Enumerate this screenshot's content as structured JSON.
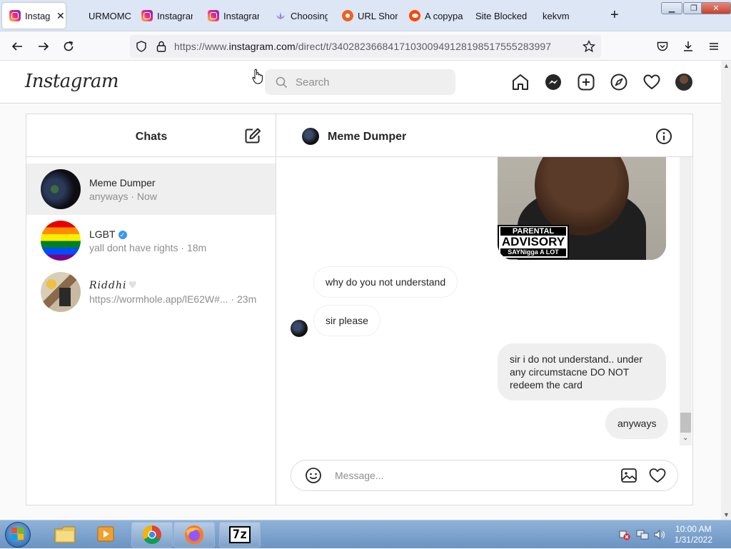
{
  "browser": {
    "tabs": [
      {
        "label": "Instagram",
        "icon": "instagram-icon",
        "active": true
      },
      {
        "label": "URMOMC",
        "icon": "none"
      },
      {
        "label": "Instagram",
        "icon": "instagram-icon"
      },
      {
        "label": "Instagram",
        "icon": "instagram-icon"
      },
      {
        "label": "Choosing",
        "icon": "lotus-icon"
      },
      {
        "label": "URL Short",
        "icon": "bitly-icon"
      },
      {
        "label": "A copypa",
        "icon": "reddit-icon"
      },
      {
        "label": "Site Blocked",
        "icon": "none"
      },
      {
        "label": "kekvm",
        "icon": "none"
      }
    ],
    "new_tab": "+",
    "url_prefix": "https://www.",
    "url_domain": "instagram.com",
    "url_path": "/direct/t/340282366841710300949128198517555283997"
  },
  "instagram": {
    "logo": "Instagram",
    "search_placeholder": "Search",
    "chats_title": "Chats",
    "chats": [
      {
        "name": "Meme Dumper",
        "last": "anyways",
        "time": "Now",
        "selected": true
      },
      {
        "name": "LGBT",
        "verified": true,
        "last": "yall dont have rights",
        "time": "18m"
      },
      {
        "name": "𝑅𝑖𝑑𝑑ℎ𝑖",
        "last": "https://wormhole.app/lE62W#...",
        "time": "23m"
      }
    ],
    "conversation": {
      "name": "Meme Dumper",
      "image_text": {
        "line1": "PARENTAL",
        "line2": "ADVISORY",
        "line3": "SAYNigga A LOT"
      },
      "messages": [
        {
          "text": "why do you not understand",
          "direction": "incoming"
        },
        {
          "text": "sir please",
          "direction": "incoming"
        },
        {
          "text": "sir i do not understand.. under any circumstacne DO NOT redeem the card",
          "direction": "outgoing"
        },
        {
          "text": "anyways",
          "direction": "outgoing"
        }
      ],
      "composer_placeholder": "Message..."
    }
  },
  "taskbar": {
    "time": "10:00 AM",
    "date": "1/31/2022",
    "seven_zip_label": "7z"
  }
}
